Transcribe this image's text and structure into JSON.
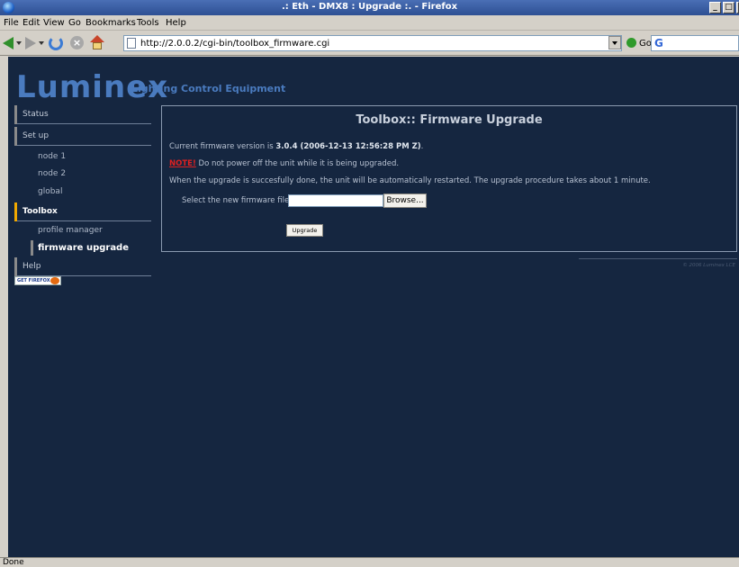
{
  "window": {
    "title": ".: Eth - DMX8 : Upgrade :. - Firefox"
  },
  "menu": {
    "items": [
      "File",
      "Edit",
      "View",
      "Go",
      "Bookmarks",
      "Tools",
      "Help"
    ]
  },
  "toolbar": {
    "url": "http://2.0.0.2/cgi-bin/toolbox_firmware.cgi",
    "go_label": "Go",
    "search_value": ""
  },
  "brand": {
    "logo": "Luminex",
    "tagline": "Lighting Control Equipment",
    "accent": "#f0a800",
    "logo_color": "#4a7bbf",
    "background": "#152640"
  },
  "sidebar": {
    "items": [
      {
        "label": "Status"
      },
      {
        "label": "Set up"
      },
      {
        "label": "node 1"
      },
      {
        "label": "node 2"
      },
      {
        "label": "global"
      },
      {
        "label": "Toolbox"
      },
      {
        "label": "profile manager"
      },
      {
        "label": "firmware upgrade"
      },
      {
        "label": "Help"
      }
    ],
    "badge": "GET FIREFOX"
  },
  "main": {
    "heading": "Toolbox:: Firmware Upgrade",
    "version_prefix": "Current firmware version is ",
    "version_value": "3.0.4 (2006-12-13 12:56:28 PM Z)",
    "version_suffix": ".",
    "note_label": "NOTE!",
    "note_text": " Do not power off the unit while it is being upgraded.",
    "info_text": "When the upgrade is succesfully done, the unit will be automatically restarted. The upgrade procedure takes about 1 minute.",
    "file_label": "Select the new firmware file:",
    "file_value": "",
    "browse_label": "Browse...",
    "upgrade_label": "Upgrade"
  },
  "footer": {
    "copyright": "© 2006 Luminex LCE"
  },
  "status": {
    "text": "Done"
  }
}
